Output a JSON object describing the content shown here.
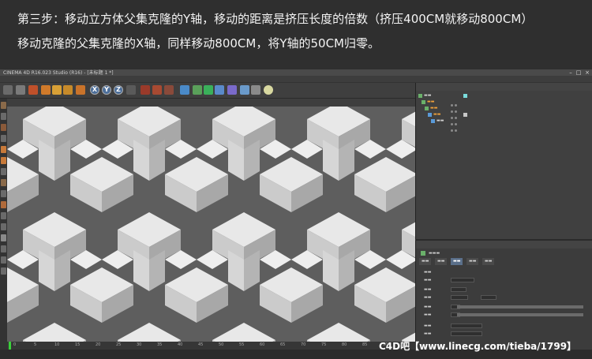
{
  "caption": {
    "line1": "第三步：移动立方体父集克隆的Y轴，移动的距离是挤压长度的倍数（挤压400CM就移动800CM）",
    "line2": "移动克隆的父集克隆的X轴，同样移动800CM，将Y轴的50CM归零。"
  },
  "window": {
    "title": "CINEMA 4D R16.023 Studio (R16) - [未标题 1 *]",
    "controls": [
      "–",
      "□",
      "×"
    ]
  },
  "toolbar": {
    "axis_x": "X",
    "axis_y": "Y",
    "axis_z": "Z"
  },
  "timeline": {
    "ticks": [
      "0",
      "5",
      "10",
      "15",
      "20",
      "25",
      "30",
      "35",
      "40",
      "45",
      "50",
      "55",
      "60",
      "65",
      "70",
      "75",
      "80",
      "85",
      "90"
    ]
  },
  "watermark": "C4D吧【www.linecg.com/tieba/1799】",
  "colors": {
    "cube_light": "#e6e6e6",
    "cube_mid": "#c9c9c9",
    "cube_dark": "#a9a9a9",
    "viewport_bg": "#5e5e5e",
    "accent_select": "#5a6f8a"
  }
}
